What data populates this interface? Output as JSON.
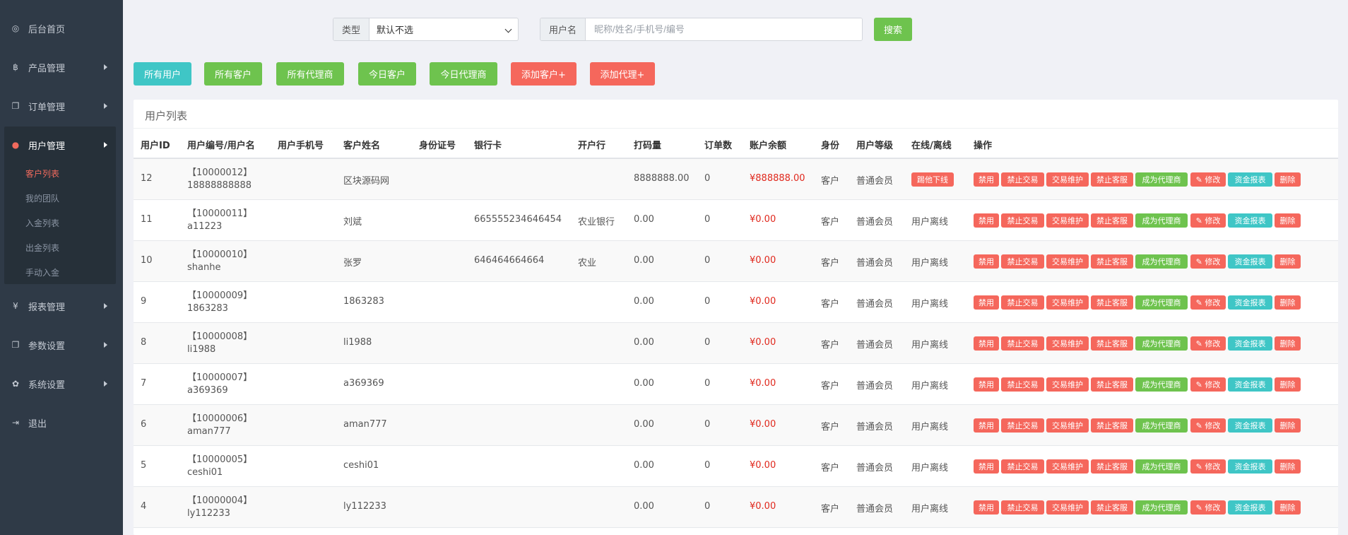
{
  "sidebar": {
    "items": [
      {
        "label": "后台首页",
        "icon": "dashboard-icon",
        "glyph": "◎"
      },
      {
        "label": "产品管理",
        "icon": "bitcoin-icon",
        "glyph": "฿"
      },
      {
        "label": "订单管理",
        "icon": "copy-icon",
        "glyph": "❐"
      },
      {
        "label": "用户管理",
        "icon": "user-icon",
        "glyph": "●"
      },
      {
        "label": "报表管理",
        "icon": "yen-icon",
        "glyph": "¥"
      },
      {
        "label": "参数设置",
        "icon": "copy-icon",
        "glyph": "❐"
      },
      {
        "label": "系统设置",
        "icon": "gears-icon",
        "glyph": "✿"
      },
      {
        "label": "退出",
        "icon": "sign-out-icon",
        "glyph": "⇥"
      }
    ],
    "sub_items": [
      "客户列表",
      "我的团队",
      "入金列表",
      "出金列表",
      "手动入金"
    ]
  },
  "filters": {
    "type_label": "类型",
    "type_value": "默认不选",
    "user_label": "用户名",
    "user_placeholder": "昵称/姓名/手机号/编号",
    "search_label": "搜索"
  },
  "actions": [
    "所有用户",
    "所有客户",
    "所有代理商",
    "今日客户",
    "今日代理商",
    "添加客户+",
    "添加代理+"
  ],
  "panel_title": "用户列表",
  "columns": [
    "用户ID",
    "用户编号/用户名",
    "用户手机号",
    "客户姓名",
    "身份证号",
    "银行卡",
    "开户行",
    "打码量",
    "订单数",
    "账户余额",
    "身份",
    "用户等级",
    "在线/离线",
    "操作"
  ],
  "row_buttons": [
    "禁用",
    "禁止交易",
    "交易维护",
    "禁止客服",
    "成为代理商",
    "✎ 修改",
    "资金报表",
    "删除"
  ],
  "colors": {
    "green": "#6ec34e",
    "teal": "#3fc6c6",
    "red": "#f5675c",
    "money": "#e0281d",
    "sidebar": "#2f3a47"
  },
  "rows": [
    {
      "id": "12",
      "code": "【10000012】",
      "username": "18888888888",
      "phone": "",
      "name": "区块源码网",
      "idcard": "",
      "bank": "",
      "branch": "",
      "volume": "8888888.00",
      "orders": "0",
      "balance": "¥888888.00",
      "role": "客户",
      "level": "普通会员",
      "online": "踢他下线",
      "is_online": true
    },
    {
      "id": "11",
      "code": "【10000011】",
      "username": "a11223",
      "phone": "",
      "name": "刘斌",
      "idcard": "",
      "bank": "665555234646454",
      "branch": "农业银行",
      "volume": "0.00",
      "orders": "0",
      "balance": "¥0.00",
      "role": "客户",
      "level": "普通会员",
      "online": "用户离线",
      "is_online": false
    },
    {
      "id": "10",
      "code": "【10000010】",
      "username": "shanhe",
      "phone": "",
      "name": "张罗",
      "idcard": "",
      "bank": "646464664664",
      "branch": "农业",
      "volume": "0.00",
      "orders": "0",
      "balance": "¥0.00",
      "role": "客户",
      "level": "普通会员",
      "online": "用户离线",
      "is_online": false
    },
    {
      "id": "9",
      "code": "【10000009】",
      "username": "1863283",
      "phone": "",
      "name": "1863283",
      "idcard": "",
      "bank": "",
      "branch": "",
      "volume": "0.00",
      "orders": "0",
      "balance": "¥0.00",
      "role": "客户",
      "level": "普通会员",
      "online": "用户离线",
      "is_online": false
    },
    {
      "id": "8",
      "code": "【10000008】",
      "username": "li1988",
      "phone": "",
      "name": "li1988",
      "idcard": "",
      "bank": "",
      "branch": "",
      "volume": "0.00",
      "orders": "0",
      "balance": "¥0.00",
      "role": "客户",
      "level": "普通会员",
      "online": "用户离线",
      "is_online": false
    },
    {
      "id": "7",
      "code": "【10000007】",
      "username": "a369369",
      "phone": "",
      "name": "a369369",
      "idcard": "",
      "bank": "",
      "branch": "",
      "volume": "0.00",
      "orders": "0",
      "balance": "¥0.00",
      "role": "客户",
      "level": "普通会员",
      "online": "用户离线",
      "is_online": false
    },
    {
      "id": "6",
      "code": "【10000006】",
      "username": "aman777",
      "phone": "",
      "name": "aman777",
      "idcard": "",
      "bank": "",
      "branch": "",
      "volume": "0.00",
      "orders": "0",
      "balance": "¥0.00",
      "role": "客户",
      "level": "普通会员",
      "online": "用户离线",
      "is_online": false
    },
    {
      "id": "5",
      "code": "【10000005】",
      "username": "ceshi01",
      "phone": "",
      "name": "ceshi01",
      "idcard": "",
      "bank": "",
      "branch": "",
      "volume": "0.00",
      "orders": "0",
      "balance": "¥0.00",
      "role": "客户",
      "level": "普通会员",
      "online": "用户离线",
      "is_online": false
    },
    {
      "id": "4",
      "code": "【10000004】",
      "username": "ly112233",
      "phone": "",
      "name": "ly112233",
      "idcard": "",
      "bank": "",
      "branch": "",
      "volume": "0.00",
      "orders": "0",
      "balance": "¥0.00",
      "role": "客户",
      "level": "普通会员",
      "online": "用户离线",
      "is_online": false
    }
  ]
}
